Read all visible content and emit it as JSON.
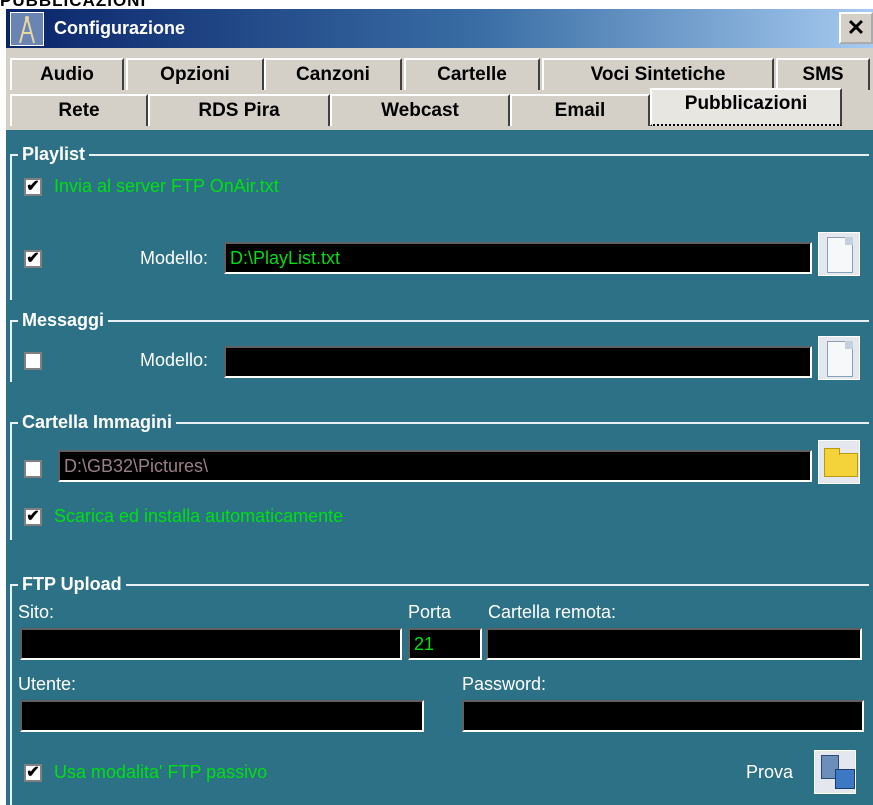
{
  "top_caption": "PUBBLICAZIONI",
  "window": {
    "title": "Configurazione",
    "close_label": "✕",
    "icon": "antenna-icon"
  },
  "tabs_row1": [
    "Audio",
    "Opzioni",
    "Canzoni",
    "Cartelle",
    "Voci Sintetiche",
    "SMS"
  ],
  "tabs_row2": [
    "Rete",
    "RDS Pira",
    "Webcast",
    "Email",
    "Pubblicazioni"
  ],
  "active_tab": "Pubblicazioni",
  "playlist": {
    "title": "Playlist",
    "send_onair_checked": true,
    "send_onair_label": "Invia al server FTP OnAir.txt",
    "model_checked": true,
    "model_label": "Modello:",
    "model_value": "D:\\PlayList.txt",
    "browse_icon": "document-icon"
  },
  "messaggi": {
    "title": "Messaggi",
    "model_checked": false,
    "model_label": "Modello:",
    "model_value": "",
    "browse_icon": "document-icon"
  },
  "cartella_immagini": {
    "title": "Cartella Immagini",
    "path_checked": false,
    "path_value": "D:\\GB32\\Pictures\\",
    "browse_icon": "folder-icon",
    "auto_install_checked": true,
    "auto_install_label": "Scarica ed installa automaticamente"
  },
  "ftp_upload": {
    "title": "FTP Upload",
    "site_label": "Sito:",
    "site_value": "",
    "port_label": "Porta",
    "port_value": "21",
    "remote_folder_label": "Cartella remota:",
    "remote_folder_value": "",
    "user_label": "Utente:",
    "user_value": "",
    "password_label": "Password:",
    "password_value": "",
    "passive_checked": true,
    "passive_label": "Usa modalita' FTP passivo",
    "test_label": "Prova",
    "test_icon": "server-connection-icon"
  },
  "check_mark": "✔",
  "colors": {
    "panel": "#2d7187",
    "field": "#000000",
    "green_text": "#00e010",
    "tab_face": "#d4d0c8"
  }
}
